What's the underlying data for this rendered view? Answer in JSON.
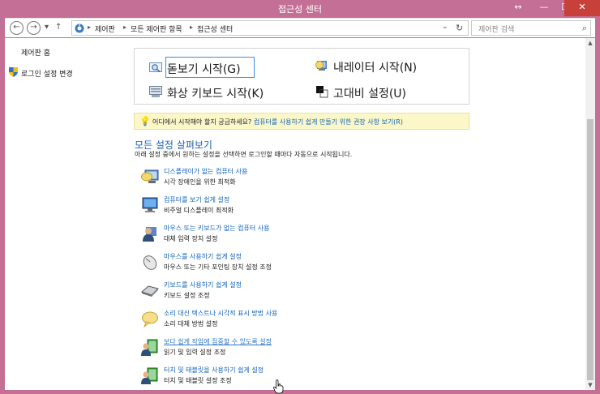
{
  "window": {
    "title": "접근성 센터",
    "controls": {
      "resize": "↔",
      "minimize": "—",
      "maximize": "☐",
      "close": "✕"
    }
  },
  "nav": {
    "back": "←",
    "forward": "→",
    "dropdown": "▾",
    "up": "↑",
    "breadcrumbs": [
      "제어판",
      "모든 제어판 항목",
      "접근성 센터"
    ],
    "breadcrumb_sep": "▸",
    "address_dropdown": "⌄",
    "refresh": "↻",
    "search_placeholder": "제어판 검색",
    "search_icon": "⌕"
  },
  "sidebar": {
    "items": [
      {
        "label": "제어판 홈"
      },
      {
        "label": "로그인 설정 변경"
      }
    ]
  },
  "tools": [
    {
      "label": "돋보기 시작(G)",
      "icon": "magnifier-icon"
    },
    {
      "label": "내레이터 시작(N)",
      "icon": "narrator-icon"
    },
    {
      "label": "화상 키보드 시작(K)",
      "icon": "keyboard-icon"
    },
    {
      "label": "고대비 설정(U)",
      "icon": "contrast-icon"
    }
  ],
  "hint": {
    "bulb": "💡",
    "text": "어디에서 시작해야 할지 궁금하세요? ",
    "link": "컴퓨터를 사용하기 쉽게 만들기 위한 권장 사항 보기(R)"
  },
  "section": {
    "title": "모든 설정 살펴보기",
    "desc": "아래 설정 중에서 원하는 설정을 선택하면 로그인할 때마다 자동으로 시작됩니다."
  },
  "settings": [
    {
      "link": "디스플레이가 없는 컴퓨터 사용",
      "desc": "시각 장애인을 위한 최적화",
      "icon": "speech-display-icon"
    },
    {
      "link": "컴퓨터를 보기 쉽게 설정",
      "desc": "비주얼 디스플레이 최적화",
      "icon": "monitor-icon"
    },
    {
      "link": "마우스 또는 키보드가 없는 컴퓨터 사용",
      "desc": "대체 입력 장치 설정",
      "icon": "person-icon"
    },
    {
      "link": "마우스를 사용하기 쉽게 설정",
      "desc": "마우스 또는 기타 포인팅 장치 설정 조정",
      "icon": "mouse-icon"
    },
    {
      "link": "키보드를 사용하기 쉽게 설정",
      "desc": "키보드 설정 조정",
      "icon": "keyboard-icon"
    },
    {
      "link": "소리 대신 텍스트나 시각적 표시 방법 사용",
      "desc": "소리 대체 방법 설정",
      "icon": "speech-bubble-icon"
    },
    {
      "link": "보다 쉽게 작업에 집중할 수 있도록 설정",
      "desc": "읽기 및 입력 설정 조정",
      "icon": "focus-user-icon"
    },
    {
      "link": "터치 및 태블릿을 사용하기 쉽게 설정",
      "desc": "터치 및 태블릿 설정 조정",
      "icon": "tablet-user-icon"
    }
  ],
  "scrollbar": {
    "up": "▲",
    "down": "▼"
  },
  "colors": {
    "accent": "#c46f95",
    "link": "#0f63b7",
    "close": "#c7403a",
    "hint_bg": "#fbf7c9"
  }
}
